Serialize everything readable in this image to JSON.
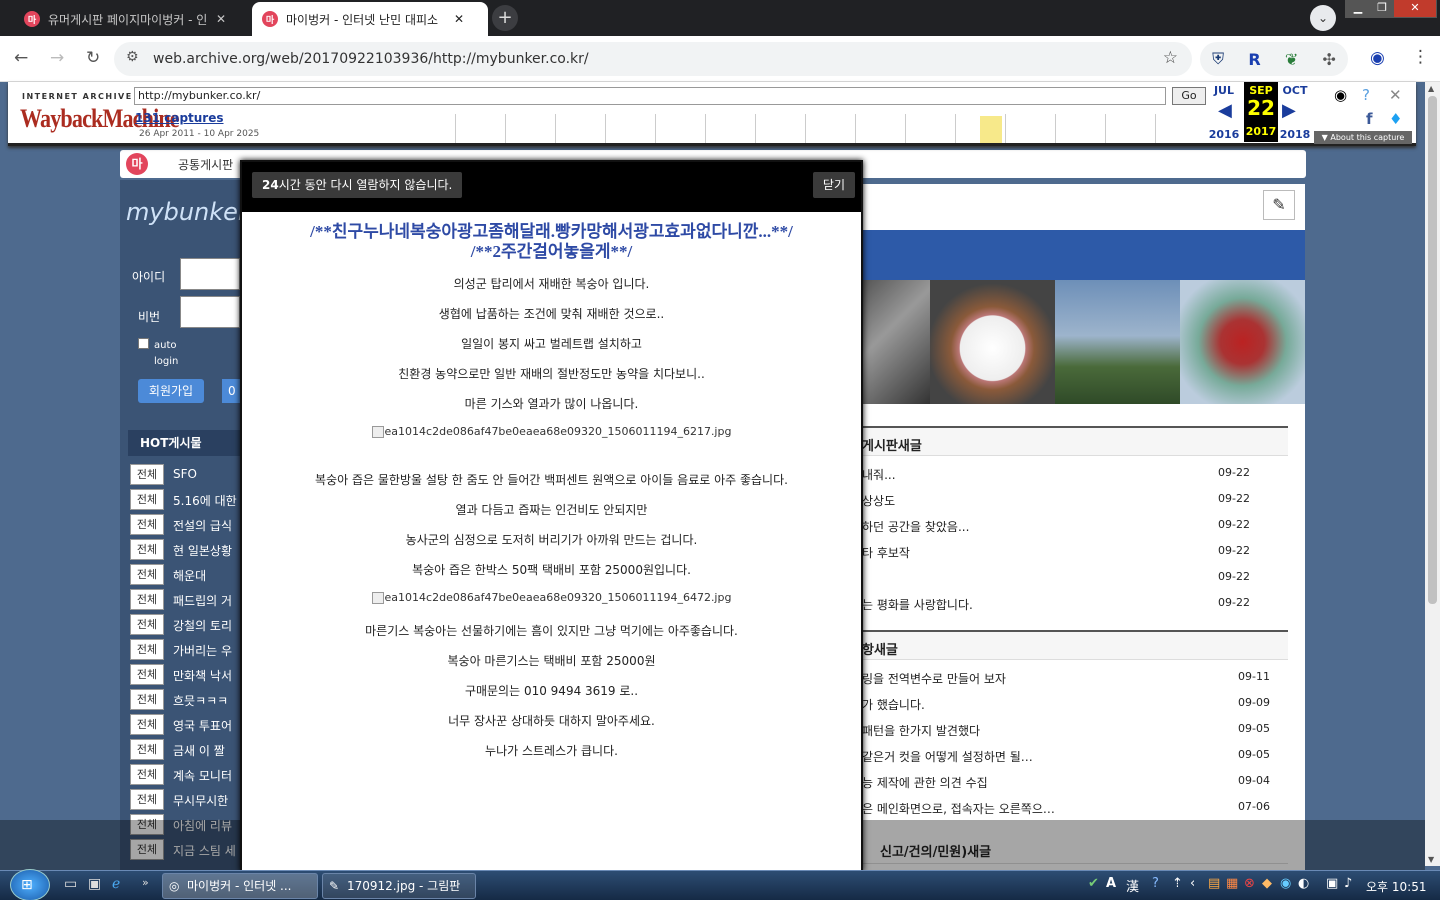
{
  "browser": {
    "tabs": [
      {
        "favicon": "마",
        "title": "유머게시판 페이지마이벙커 - 인",
        "active": false
      },
      {
        "favicon": "마",
        "title": "마이벙커 - 인터넷 난민 대피소",
        "active": true
      }
    ],
    "new_tab": "+",
    "url": "web.archive.org/web/20170922103936/http://mybunker.co.kr/"
  },
  "wayback": {
    "ia_label": "INTERNET ARCHIVE",
    "logo": "WaybackMachine",
    "url_input": "http://mybunker.co.kr/",
    "go_label": "Go",
    "captures": "131 captures",
    "date_range": "26 Apr 2011 - 10 Apr 2025",
    "prev_month": "JUL",
    "prev_year": "2016",
    "sel_month": "SEP",
    "sel_day": "22",
    "sel_year": "2017",
    "next_month": "OCT",
    "next_year": "2018",
    "about": "▼ About this capture",
    "sparkline": [
      0,
      0,
      0,
      0,
      0,
      0,
      0,
      0,
      0,
      0,
      0,
      0,
      0,
      0,
      0,
      0,
      0,
      0,
      0,
      0,
      0,
      0,
      0,
      0,
      0,
      0,
      0,
      0,
      0,
      0,
      0,
      0,
      0,
      0,
      0,
      0,
      0,
      0,
      0,
      0,
      0,
      0,
      0,
      0,
      0,
      0,
      0,
      0,
      0,
      0,
      0,
      0,
      0,
      0,
      0,
      0,
      0,
      0,
      0,
      0,
      0,
      0,
      0,
      0,
      0,
      0,
      0,
      0,
      0,
      0,
      0,
      0,
      0,
      0,
      0,
      0,
      0,
      0,
      0,
      0,
      0,
      0,
      0,
      0,
      0,
      0,
      0,
      0,
      0,
      0,
      0,
      0,
      0,
      0,
      0,
      0,
      0,
      0,
      0,
      0,
      0,
      0,
      0,
      0,
      0,
      0,
      0,
      0,
      0,
      0,
      0,
      0,
      0,
      0,
      0,
      0,
      0,
      0,
      0,
      0,
      0,
      0,
      0,
      0,
      0,
      0,
      0,
      0,
      0,
      0,
      0,
      0,
      0,
      0,
      0,
      0,
      0,
      0,
      0,
      0,
      0,
      0,
      0,
      0,
      0,
      0,
      0,
      0,
      0,
      0,
      0,
      0,
      0,
      0,
      0,
      0,
      0,
      0,
      0,
      0,
      0,
      0,
      0,
      0,
      0,
      0,
      0,
      0,
      0,
      0,
      0,
      0,
      0,
      0,
      0,
      0,
      0,
      0,
      0,
      0,
      0,
      0,
      0,
      0,
      0,
      0,
      0,
      0,
      0,
      0,
      0,
      0,
      0,
      0,
      0,
      0,
      0,
      0,
      0,
      0,
      0,
      0,
      0,
      0,
      0,
      0,
      0,
      0,
      0,
      0,
      0,
      0,
      0,
      0,
      0,
      0,
      0,
      0,
      0,
      0,
      0,
      0,
      0,
      0,
      0,
      0,
      0,
      0,
      0,
      0,
      0,
      0,
      0,
      0,
      0,
      0,
      0,
      0,
      0,
      0,
      0,
      0,
      0,
      0,
      0,
      0,
      0,
      0,
      0,
      0,
      0,
      0,
      0,
      0,
      0,
      0,
      0,
      0,
      0,
      0,
      0,
      0,
      0,
      0,
      0,
      0,
      0,
      0,
      0,
      0,
      0,
      0,
      0,
      0,
      0,
      0,
      0,
      0,
      0,
      0,
      0,
      0,
      0,
      0,
      0,
      0,
      0,
      0,
      0,
      0,
      0,
      0,
      0,
      0,
      0,
      0,
      0,
      0,
      0,
      0,
      0,
      0,
      0,
      0,
      0,
      0,
      0,
      0,
      0,
      0,
      0,
      0,
      0,
      0,
      0,
      0,
      0,
      0,
      0,
      0,
      0,
      0,
      0,
      0,
      0,
      0,
      0,
      0,
      0,
      0,
      0,
      0,
      0,
      0,
      0,
      0,
      0,
      0,
      0,
      0,
      0,
      0,
      0,
      0,
      0,
      0,
      0,
      0,
      0,
      0,
      0,
      0,
      0,
      0,
      0,
      0,
      0,
      0,
      0,
      0,
      0,
      0,
      0,
      0,
      0,
      0,
      0,
      0,
      0,
      0,
      0,
      0,
      0,
      0,
      0,
      0,
      0,
      0,
      0,
      0,
      0,
      0,
      0,
      0,
      0,
      0,
      0,
      0,
      0,
      0,
      0,
      0,
      0,
      0,
      0,
      0,
      0,
      0,
      0,
      0,
      0,
      0,
      0,
      0,
      0,
      0,
      0,
      0,
      0,
      0,
      0,
      0,
      0,
      0,
      0,
      0,
      0,
      0,
      0,
      0,
      0,
      0,
      0,
      0,
      0,
      0,
      0,
      0,
      0,
      0,
      0,
      0,
      0,
      0,
      0,
      0,
      0,
      0,
      0,
      0,
      0,
      0,
      0,
      0,
      0,
      0,
      0,
      0,
      0,
      0,
      0,
      0,
      0,
      0,
      0,
      0,
      0,
      0,
      0,
      0,
      0,
      0,
      0,
      0,
      0,
      0,
      0,
      0,
      0,
      0,
      0,
      0,
      0,
      0,
      0,
      0,
      0,
      0,
      0,
      0,
      0,
      0,
      0,
      0,
      0,
      0,
      0,
      0,
      0,
      0,
      0,
      0,
      0,
      0,
      0,
      0,
      0,
      0,
      0,
      0,
      0,
      0,
      0,
      0,
      0,
      0,
      0,
      0,
      0,
      0,
      0,
      0,
      0,
      0,
      0,
      0,
      0,
      0,
      0,
      0,
      0,
      0,
      0,
      0,
      0,
      0,
      0,
      0,
      0,
      0,
      0,
      0,
      0,
      0,
      0,
      0,
      0,
      0,
      0,
      0,
      0,
      0,
      0,
      0,
      0,
      0,
      0,
      0,
      0,
      0,
      0,
      0,
      0,
      0,
      0,
      0,
      0,
      0,
      0,
      0,
      0,
      0,
      0,
      0,
      0,
      0,
      0,
      0,
      0,
      0,
      0,
      0,
      0,
      0,
      0,
      0,
      0,
      0,
      0,
      0,
      0,
      0,
      0,
      0,
      0,
      0,
      0,
      0,
      0,
      0,
      0,
      0,
      0,
      0,
      0,
      0,
      0,
      0,
      0,
      0,
      0,
      0,
      0,
      0,
      0,
      0,
      0,
      0,
      0,
      0,
      0,
      0,
      0,
      0,
      0,
      0,
      0,
      0,
      0,
      0,
      0,
      0,
      0,
      0,
      0,
      0,
      0,
      0,
      0,
      0,
      0,
      0,
      0,
      0,
      0,
      0,
      0,
      0,
      0,
      0,
      0,
      0,
      0,
      0,
      0,
      0,
      0,
      0,
      0,
      0,
      0,
      0,
      0,
      0,
      0,
      0,
      0,
      0,
      0,
      0,
      0,
      0,
      0,
      0,
      0,
      0,
      0,
      0,
      0,
      0,
      0,
      0,
      0,
      0,
      0,
      0,
      0,
      0,
      0,
      0,
      0,
      0,
      0,
      0,
      0,
      0,
      0,
      0,
      0,
      0,
      0,
      0,
      0,
      0,
      0,
      0,
      0,
      0,
      0,
      0,
      0,
      0,
      0,
      0,
      0,
      0,
      0,
      0,
      0,
      0,
      0,
      0,
      0,
      0,
      0,
      0,
      0,
      0,
      0,
      0,
      0,
      0,
      0,
      0,
      0,
      0,
      0,
      0,
      0,
      0,
      0,
      0,
      0,
      0,
      0,
      0,
      0,
      0,
      0,
      0,
      0,
      0,
      0,
      0,
      0,
      0,
      0,
      0,
      0,
      0,
      0,
      0,
      0,
      0,
      0,
      0,
      0,
      0,
      0,
      0,
      0,
      0,
      0,
      0,
      0,
      0,
      0,
      0,
      0,
      0,
      0,
      0,
      0,
      0,
      0,
      0,
      0,
      0,
      0,
      0,
      0,
      0,
      0,
      0,
      0,
      0,
      0,
      0,
      0,
      0,
      0,
      0,
      0,
      0,
      0,
      0,
      0,
      0,
      0,
      0,
      0,
      0,
      0,
      0,
      0,
      0,
      0,
      0,
      0,
      0,
      0,
      0,
      0,
      0,
      0,
      0,
      0,
      0,
      0,
      0,
      0,
      0,
      0,
      0,
      0,
      0,
      0,
      0,
      0,
      0,
      0,
      0,
      0,
      0,
      0,
      0,
      0,
      0,
      0,
      0,
      0,
      0,
      0,
      0,
      0,
      0,
      0,
      0,
      0,
      0,
      0,
      0,
      0,
      0,
      0,
      0,
      0,
      0,
      0,
      0,
      0,
      0,
      0,
      0,
      0,
      0,
      0,
      0,
      0,
      0,
      0,
      0,
      0,
      0,
      0,
      0,
      0
    ]
  },
  "site": {
    "favicon": "마",
    "menu": "공통게시판",
    "logo": "mybunker",
    "login": {
      "id_label": "아이디",
      "pw_label": "비번",
      "auto_label": "auto login",
      "join": "회원가입",
      "other": "0"
    },
    "hot_title": "HOT게시물",
    "hot_items": [
      {
        "badge": "전체",
        "title": "SFO"
      },
      {
        "badge": "전체",
        "title": "5.16에 대한"
      },
      {
        "badge": "전체",
        "title": "전설의 급식"
      },
      {
        "badge": "전체",
        "title": "현 일본상황"
      },
      {
        "badge": "전체",
        "title": "해운대"
      },
      {
        "badge": "전체",
        "title": "패드립의 거"
      },
      {
        "badge": "전체",
        "title": "강철의 토리"
      },
      {
        "badge": "전체",
        "title": "가버리는 우"
      },
      {
        "badge": "전체",
        "title": "만화책 낙서"
      },
      {
        "badge": "전체",
        "title": "흐믓ㅋㅋㅋ"
      },
      {
        "badge": "전체",
        "title": "영국 투표어"
      },
      {
        "badge": "전체",
        "title": "금새 이 짤"
      },
      {
        "badge": "전체",
        "title": "계속 모니터"
      },
      {
        "badge": "전체",
        "title": "무시무시한"
      },
      {
        "badge": "전체",
        "title": "아침에 리뷰"
      },
      {
        "badge": "전체",
        "title": "지금 스팀 세"
      }
    ],
    "board1_title": "게시판새글",
    "board1": [
      {
        "title": "내줘...",
        "date": "09-22"
      },
      {
        "title": "상상도",
        "date": "09-22"
      },
      {
        "title": "하던 공간을 찾았음...",
        "date": "09-22"
      },
      {
        "title": "타 후보작",
        "date": "09-22"
      },
      {
        "title": "",
        "date": "09-22"
      },
      {
        "title": "는 평화를 사랑합니다.",
        "date": "09-22"
      }
    ],
    "board2_title": "항새글",
    "board2": [
      {
        "title": "링을 전역변수로 만들어 보자",
        "date": "09-11"
      },
      {
        "title": "가 했습니다.",
        "date": "09-09"
      },
      {
        "title": "패턴을 한가지 발견했다",
        "date": "09-05"
      },
      {
        "title": "같은거 컷을 어떻게 설정하면 될…",
        "date": "09-05"
      },
      {
        "title": "능 제작에 관한 의견 수집",
        "date": "09-04"
      },
      {
        "title": "은 메인화면으로, 접속자는 오른쪽으…",
        "date": "07-06"
      }
    ],
    "board3_title": "신고/건의/민원)새글"
  },
  "popup": {
    "dont_show_bold": "24",
    "dont_show": "시간 동안 다시 열람하지 않습니다.",
    "close": "닫기",
    "title_line1": "/**친구누나네복숭아광고좀해달래.빵카망해서광고효과없다니깐...**/",
    "title_line2": "/**2주간걸어놓을게**/",
    "lines": [
      "의성군 탑리에서 재배한 복숭아 입니다.",
      "생협에 납품하는 조건에 맞춰 재배한 것으로..",
      "일일이 봉지 싸고 벌레트랩 설치하고",
      "친환경 농약으로만 일반 재배의 절반정도만 농약을 치다보니..",
      "마른 기스와 열과가 많이 나옵니다."
    ],
    "image1": "ea1014c2de086af47be0eaea68e09320_1506011194_6217.jpg",
    "lines2": [
      "복숭아 즙은 물한방울 설탕 한 줌도 안 들어간 백퍼센트 원액으로 아이들 음료로 아주 좋습니다.",
      "열과 다듬고 즙짜는 인건비도 안되지만",
      "농사군의 심정으로 도저히 버리기가 아까워 만드는 겁니다.",
      "복숭아 즙은 한박스 50팩 택배비 포함 25000원입니다."
    ],
    "image2": "ea1014c2de086af47be0eaea68e09320_1506011194_6472.jpg",
    "lines3": [
      "마른기스 복숭아는 선물하기에는 흠이 있지만 그냥 먹기에는 아주좋습니다.",
      "복숭아 마른기스는 택배비 포함 25000원",
      "구매문의는  010 9494 3619 로..",
      "너무 장사꾼 상대하듯 대하지 말아주세요.",
      "누나가 스트레스가 큽니다."
    ]
  },
  "taskbar": {
    "tasks": [
      {
        "title": "마이벙커 - 인터넷 ..."
      },
      {
        "title": "170912.jpg - 그림판"
      }
    ],
    "clock": "오후 10:51",
    "ime_a": "A",
    "ime_han": "漢"
  }
}
